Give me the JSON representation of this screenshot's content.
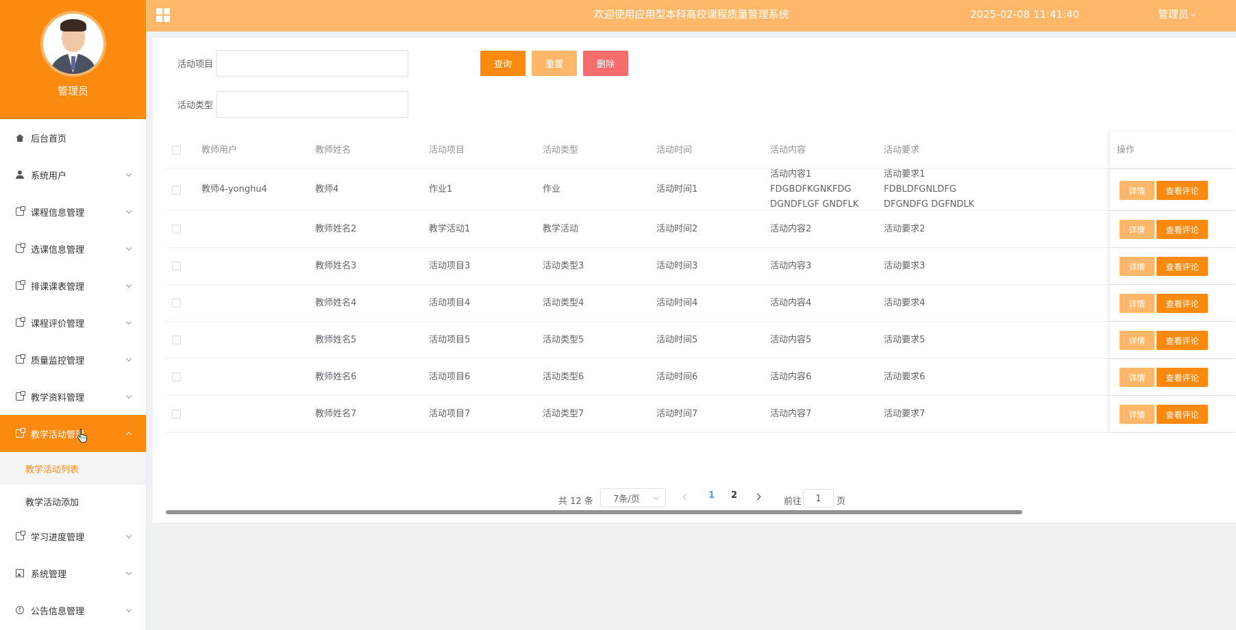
{
  "sidebar": {
    "profile_name": "管理员",
    "menu": [
      {
        "label": "后台首页",
        "icon": "home-icon"
      },
      {
        "label": "系统用户",
        "icon": "user-icon"
      },
      {
        "label": "课程信息管理",
        "icon": "document-icon"
      },
      {
        "label": "选课信息管理",
        "icon": "document-icon"
      },
      {
        "label": "排课课表管理",
        "icon": "document-icon"
      },
      {
        "label": "课程评价管理",
        "icon": "document-icon"
      },
      {
        "label": "质量监控管理",
        "icon": "document-icon"
      },
      {
        "label": "教学资料管理",
        "icon": "document-icon"
      },
      {
        "label": "教学活动管理",
        "icon": "document-icon",
        "active": true
      },
      {
        "label": "学习进度管理",
        "icon": "document-icon"
      },
      {
        "label": "系统管理",
        "icon": "picture-icon"
      },
      {
        "label": "公告信息管理",
        "icon": "info-icon"
      }
    ],
    "submenu": [
      {
        "label": "教学活动列表",
        "current": true
      },
      {
        "label": "教学活动添加"
      }
    ]
  },
  "header": {
    "title": "欢迎使用应用型本科高校课程质量管理系统",
    "datetime": "2025-02-08 11:41:40",
    "user": "管理员"
  },
  "search": {
    "project_label": "活动项目",
    "project_value": "",
    "type_label": "活动类型",
    "type_value": "",
    "query_button": "查询",
    "reset_button": "重置",
    "delete_button": "删除"
  },
  "table": {
    "columns": [
      "教师用户",
      "教师姓名",
      "活动项目",
      "活动类型",
      "活动时间",
      "活动内容",
      "活动要求",
      "操作"
    ],
    "detail_button": "详情",
    "review_button": "查看评论",
    "rows": [
      [
        "教师4-yonghu4",
        "教师4",
        "作业1",
        "作业",
        "活动时间1",
        "活动内容1 FDGBDFKGNKFDG DGNDFLGF GNDFLK",
        "活动要求1 FDBLDFGNLDFG DFGNDFG DGFNDLK"
      ],
      [
        "",
        "教师姓名2",
        "教学活动1",
        "教学活动",
        "活动时间2",
        "活动内容2",
        "活动要求2"
      ],
      [
        "",
        "教师姓名3",
        "活动项目3",
        "活动类型3",
        "活动时间3",
        "活动内容3",
        "活动要求3"
      ],
      [
        "",
        "教师姓名4",
        "活动项目4",
        "活动类型4",
        "活动时间4",
        "活动内容4",
        "活动要求4"
      ],
      [
        "",
        "教师姓名5",
        "活动项目5",
        "活动类型5",
        "活动时间5",
        "活动内容5",
        "活动要求5"
      ],
      [
        "",
        "教师姓名6",
        "活动项目6",
        "活动类型6",
        "活动时间6",
        "活动内容6",
        "活动要求6"
      ],
      [
        "",
        "教师姓名7",
        "活动项目7",
        "活动类型7",
        "活动时间7",
        "活动内容7",
        "活动要求7"
      ]
    ]
  },
  "pagination": {
    "total": "共 12 条",
    "page_size": "7条/页",
    "pages": [
      "1",
      "2"
    ],
    "current_page": "1",
    "goto_label": "前往",
    "goto_value": "1",
    "page_unit": "页"
  },
  "colors": {
    "accent": "#fb8a10",
    "header_bg": "#ffb86a",
    "danger": "#f56c6c",
    "page_active": "#409eff"
  }
}
